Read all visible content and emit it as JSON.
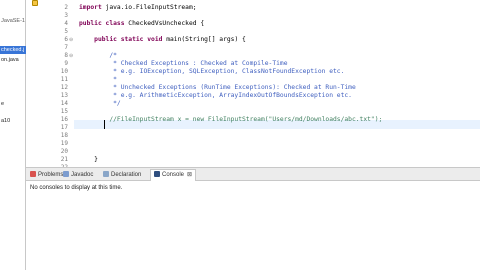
{
  "explorer": {
    "items": [
      "JavaSE-1",
      "checked.j",
      "on.java",
      "e",
      "a10"
    ]
  },
  "editor": {
    "lines": [
      {
        "n": "2",
        "code": [
          {
            "t": "import",
            "c": "kw"
          },
          {
            "t": " java.io.FileInputStream;",
            "c": ""
          }
        ]
      },
      {
        "n": "3",
        "code": []
      },
      {
        "n": "4",
        "code": [
          {
            "t": "public",
            "c": "kw"
          },
          {
            "t": " ",
            "c": ""
          },
          {
            "t": "class",
            "c": "kw"
          },
          {
            "t": " CheckedVsUnchecked {",
            "c": ""
          }
        ]
      },
      {
        "n": "5",
        "code": []
      },
      {
        "n": "6",
        "fold": "⊖",
        "code": [
          {
            "t": "    ",
            "c": ""
          },
          {
            "t": "public",
            "c": "kw"
          },
          {
            "t": " ",
            "c": ""
          },
          {
            "t": "static",
            "c": "kw"
          },
          {
            "t": " ",
            "c": ""
          },
          {
            "t": "void",
            "c": "kw"
          },
          {
            "t": " main(String[] args) {",
            "c": ""
          }
        ]
      },
      {
        "n": "7",
        "code": []
      },
      {
        "n": "8",
        "fold": "⊖",
        "code": [
          {
            "t": "        /*",
            "c": "cm"
          }
        ]
      },
      {
        "n": "9",
        "code": [
          {
            "t": "         * Checked Exceptions : Checked at Compile-Time",
            "c": "cm"
          }
        ]
      },
      {
        "n": "10",
        "code": [
          {
            "t": "         * e.g. IOException, SQLException, ClassNotFoundException etc.",
            "c": "cm"
          }
        ]
      },
      {
        "n": "11",
        "code": [
          {
            "t": "         *",
            "c": "cm"
          }
        ]
      },
      {
        "n": "12",
        "code": [
          {
            "t": "         * Unchecked Exceptions (RunTime Exceptions): Checked at Run-Time",
            "c": "cm"
          }
        ]
      },
      {
        "n": "13",
        "code": [
          {
            "t": "         * e.g. ArithmeticException, ArrayIndexOutOfBoundsException etc.",
            "c": "cm"
          }
        ]
      },
      {
        "n": "14",
        "code": [
          {
            "t": "         */",
            "c": "cm"
          }
        ]
      },
      {
        "n": "15",
        "code": []
      },
      {
        "n": "16",
        "code": [
          {
            "t": "        //FileInputStream x = new FileInputStream(\"Users/md/Downloads/abc.txt\");",
            "c": "lc"
          }
        ]
      },
      {
        "n": "17",
        "code": []
      },
      {
        "n": "18",
        "code": []
      },
      {
        "n": "19",
        "code": []
      },
      {
        "n": "20",
        "code": []
      },
      {
        "n": "21",
        "code": [
          {
            "t": "    }",
            "c": ""
          }
        ]
      },
      {
        "n": "22",
        "code": []
      },
      {
        "n": "23",
        "code": [
          {
            "t": "}",
            "c": ""
          }
        ]
      },
      {
        "n": "24",
        "code": []
      }
    ]
  },
  "bottom": {
    "tabs": {
      "problems": "Problems",
      "javadoc": "Javadoc",
      "declaration": "Declaration",
      "console": "Console"
    },
    "console_close": "⊠",
    "console_message": "No consoles to display at this time."
  },
  "colors": {
    "keyword": "#7f0055",
    "javadoc_comment": "#3f5fbf",
    "line_comment": "#3f7f5f",
    "selection": "#3875d7",
    "current_line": "#e8f2fe"
  }
}
